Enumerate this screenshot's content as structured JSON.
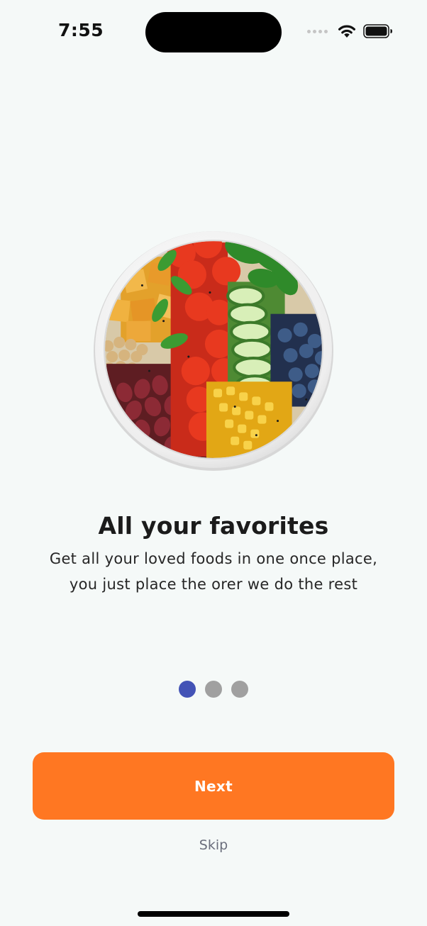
{
  "status_bar": {
    "time": "7:55"
  },
  "onboarding": {
    "image_icon": "food-bowl-image",
    "title": "All your favorites",
    "subtitle_line1": "Get all your loved foods in one once place,",
    "subtitle_line2": "you just place the orer we do the rest",
    "pager": {
      "count": 3,
      "active_index": 0
    }
  },
  "actions": {
    "next_label": "Next",
    "skip_label": "Skip"
  },
  "colors": {
    "background": "#F5F9F8",
    "accent": "#FF7722",
    "active_dot": "#4353B6",
    "inactive_dot": "#A0A0A0",
    "skip_text": "#6A6E7C"
  }
}
